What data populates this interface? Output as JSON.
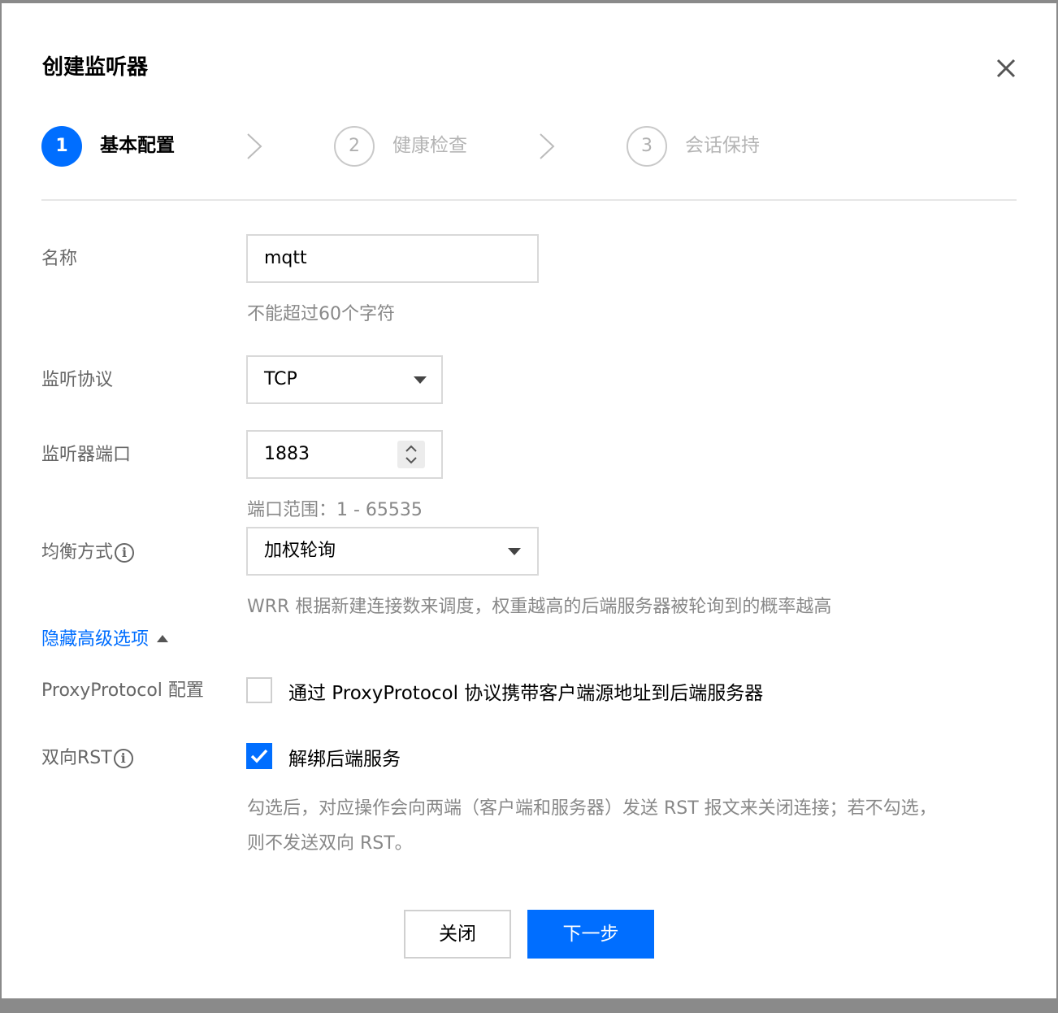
{
  "dialog": {
    "title": "创建监听器"
  },
  "steps": [
    {
      "number": "1",
      "label": "基本配置",
      "state": "active"
    },
    {
      "number": "2",
      "label": "健康检查",
      "state": "pending"
    },
    {
      "number": "3",
      "label": "会话保持",
      "state": "pending"
    }
  ],
  "form": {
    "name": {
      "label": "名称",
      "value": "mqtt",
      "help": "不能超过60个字符"
    },
    "protocol": {
      "label": "监听协议",
      "value": "TCP"
    },
    "port": {
      "label": "监听器端口",
      "value": "1883",
      "help": "端口范围：1 - 65535"
    },
    "balance": {
      "label": "均衡方式",
      "value": "加权轮询",
      "help": "WRR 根据新建连接数来调度，权重越高的后端服务器被轮询到的概率越高"
    },
    "advanced_toggle": "隐藏高级选项",
    "proxy_protocol": {
      "label": "ProxyProtocol 配置",
      "checkbox_label": "通过 ProxyProtocol 协议携带客户端源地址到后端服务器",
      "checked": false
    },
    "rst": {
      "label": "双向RST",
      "checkbox_label": "解绑后端服务",
      "checked": true,
      "help_line1": "勾选后，对应操作会向两端（客户端和服务器）发送 RST 报文来关闭连接；若不勾选，",
      "help_line2": "则不发送双向 RST。"
    }
  },
  "buttons": {
    "close": "关闭",
    "next": "下一步"
  },
  "colors": {
    "primary": "#006eff",
    "border": "#d9d9d9",
    "muted_text": "#888888"
  }
}
